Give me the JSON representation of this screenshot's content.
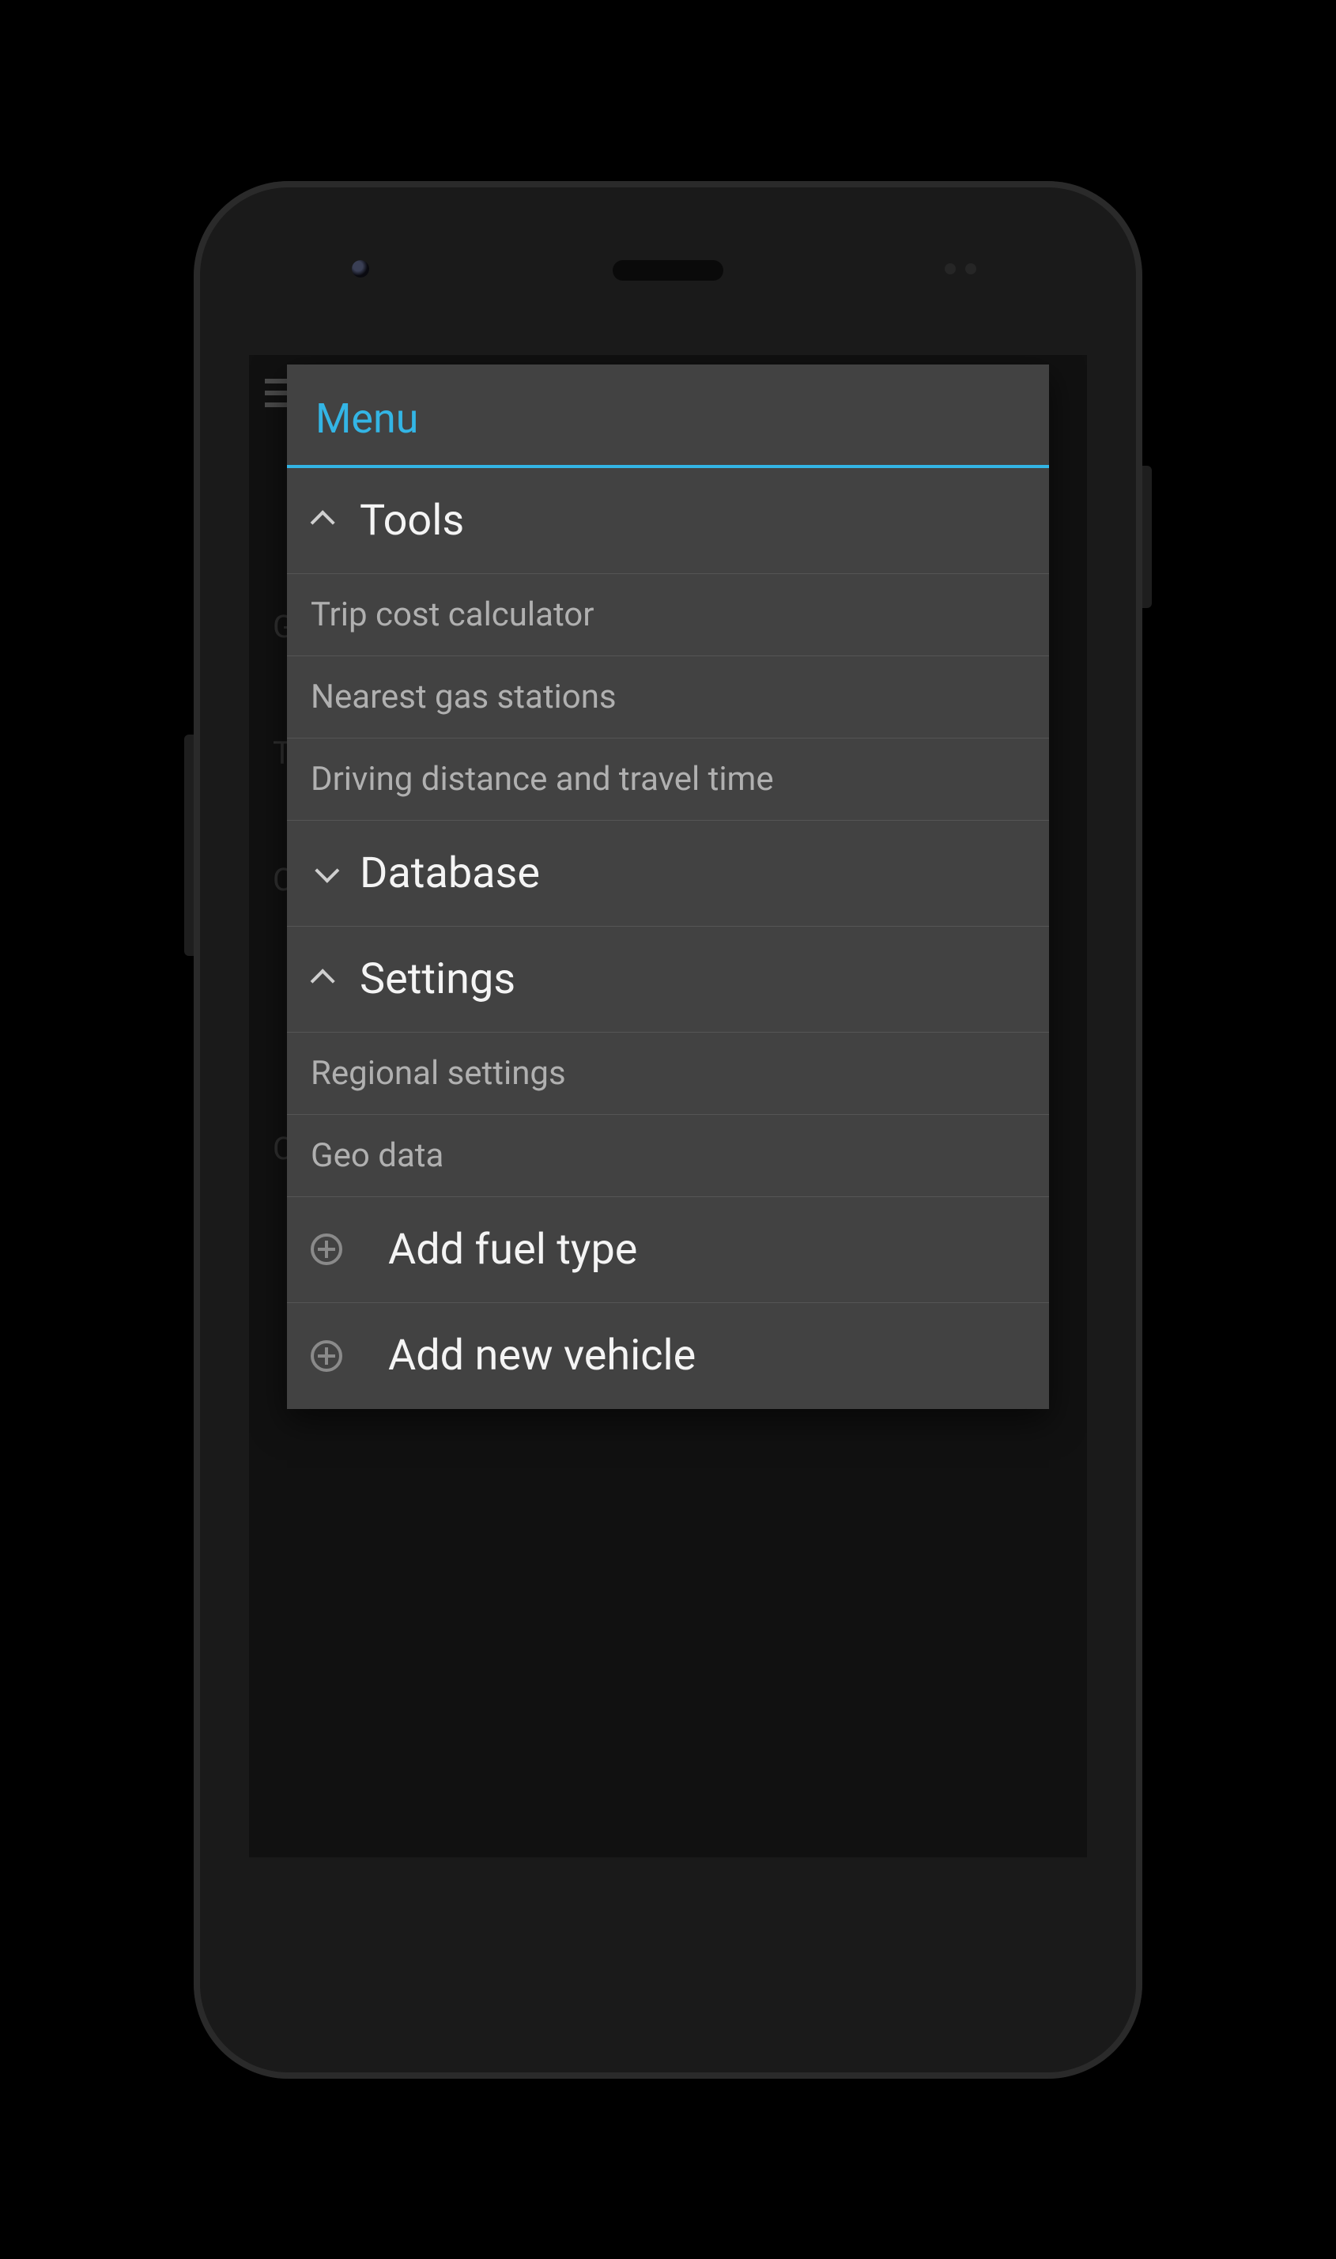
{
  "dialog": {
    "title": "Menu",
    "sections": [
      {
        "label": "Tools",
        "expanded": true,
        "items": [
          {
            "label": "Trip cost calculator"
          },
          {
            "label": "Nearest gas stations"
          },
          {
            "label": "Driving distance and travel time"
          }
        ]
      },
      {
        "label": "Database",
        "expanded": false,
        "items": []
      },
      {
        "label": "Settings",
        "expanded": true,
        "items": [
          {
            "label": "Regional settings"
          },
          {
            "label": "Geo data"
          }
        ]
      }
    ],
    "actions": [
      {
        "label": "Add fuel type"
      },
      {
        "label": "Add new vehicle"
      }
    ]
  },
  "background_app": {
    "visible_letters": [
      "G",
      "T",
      "C",
      "C"
    ]
  }
}
